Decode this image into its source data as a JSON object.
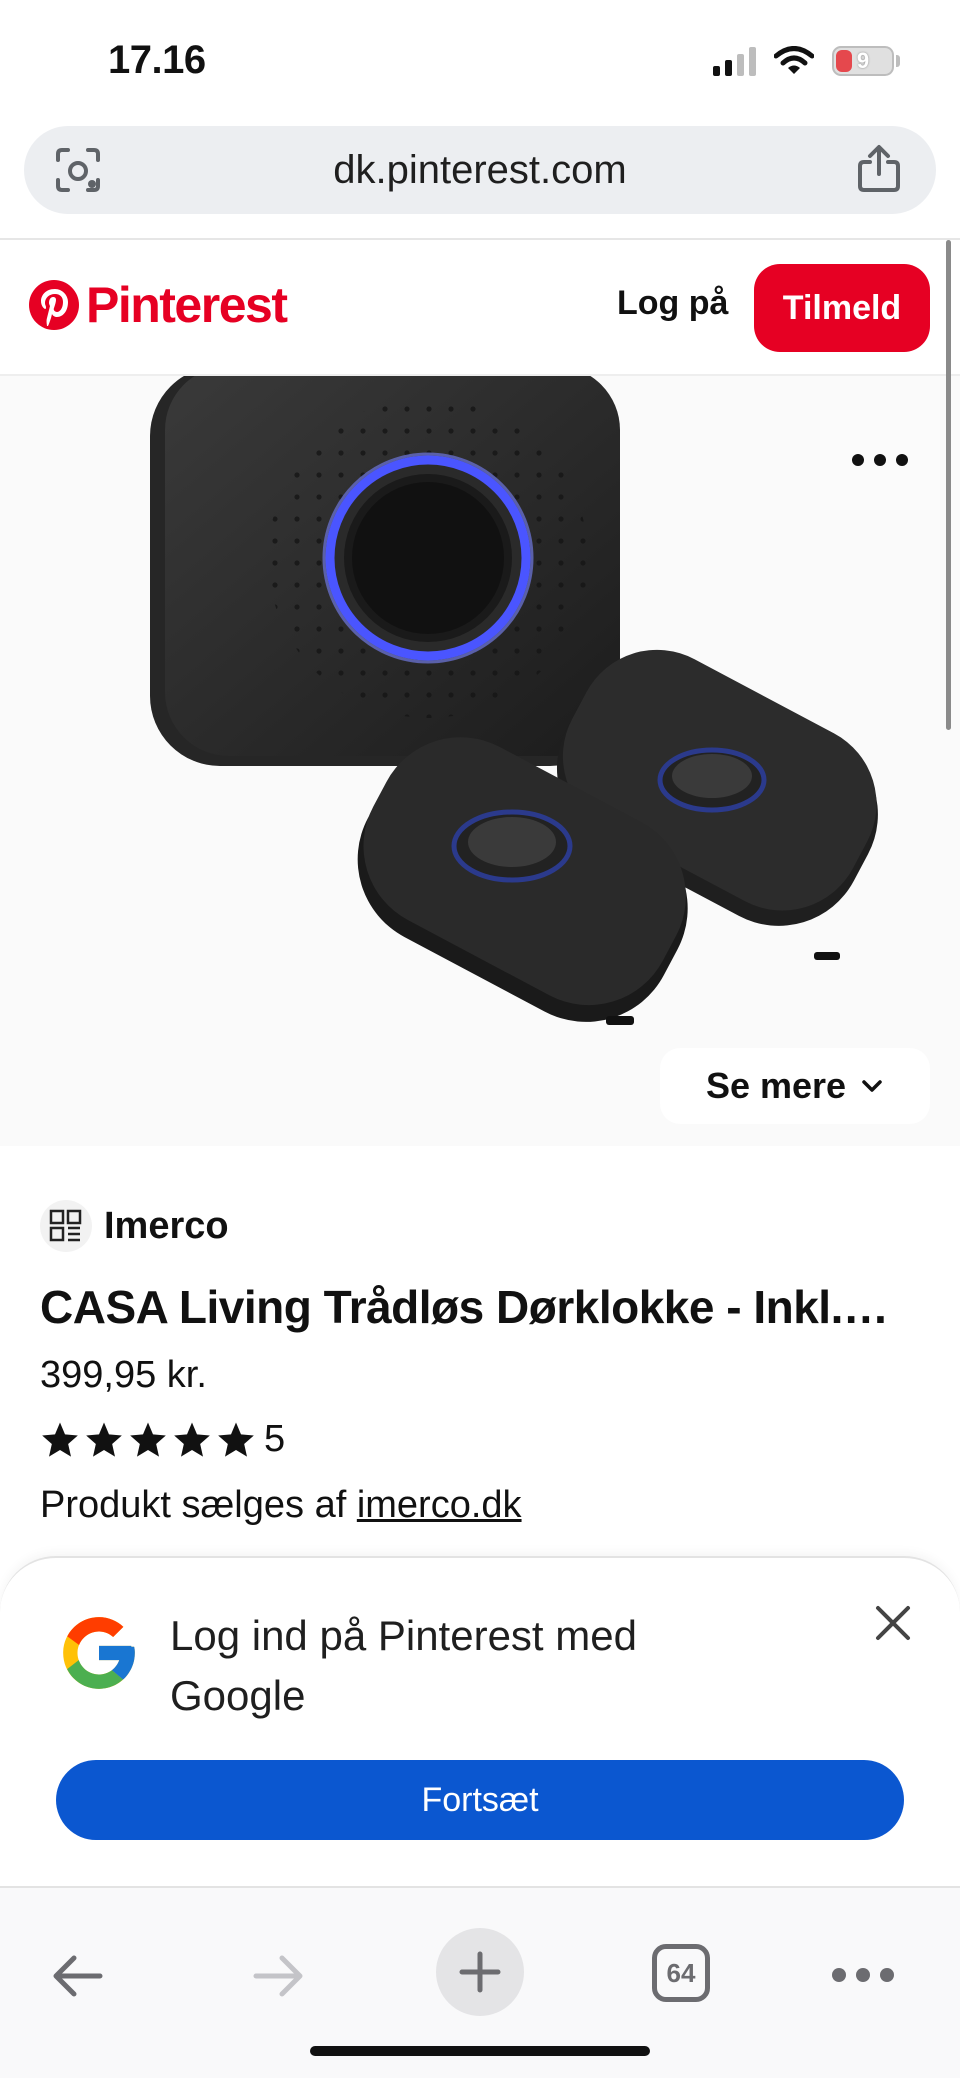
{
  "status_bar": {
    "time": "17.16",
    "battery": "9",
    "icons": [
      "signal-icon",
      "wifi-icon",
      "battery-icon"
    ]
  },
  "browser": {
    "url": "dk.pinterest.com",
    "left_icon": "camera-scan-icon",
    "right_icon": "share-icon"
  },
  "header": {
    "logo_text": "Pinterest",
    "login_label": "Log på",
    "signup_label": "Tilmeld",
    "brand_color": "#e60023"
  },
  "pin": {
    "more_icon": "more-icon",
    "see_more_label": "Se mere",
    "seller": "Imerco",
    "title": "CASA Living Trådløs Dørklokke - Inkl.…",
    "price": "399,95 kr.",
    "rating": 5,
    "rating_text": "5",
    "sold_by_prefix": "Produkt sælges af ",
    "sold_by_link": "imerco.dk"
  },
  "google_prompt": {
    "title": "Log ind på Pinterest med Google",
    "continue_label": "Fortsæt",
    "button_color": "#0b57d0"
  },
  "toolbar": {
    "tab_count": "64",
    "icons": [
      "back-arrow-icon",
      "forward-arrow-icon",
      "plus-icon",
      "tabs-icon",
      "more-icon"
    ]
  }
}
